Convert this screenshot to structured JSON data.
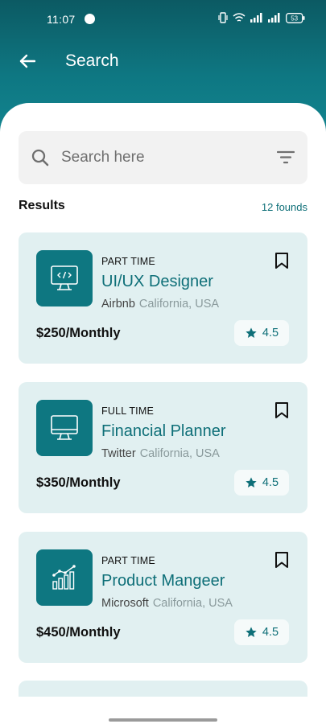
{
  "status_bar": {
    "time": "11:07",
    "battery": "53"
  },
  "header": {
    "title": "Search",
    "back_icon": "arrow-left-icon"
  },
  "search": {
    "placeholder": "Search here",
    "value": "",
    "icon": "search-icon",
    "filter_icon": "filter-icon"
  },
  "results": {
    "title": "Results",
    "count": "12 founds"
  },
  "jobs": [
    {
      "type": "PART TIME",
      "title": "UI/UX Designer",
      "company": "Airbnb",
      "location": "California, USA",
      "salary": "$250/Monthly",
      "rating": "4.5",
      "logo_icon": "code-monitor-icon"
    },
    {
      "type": "FULL TIME",
      "title": "Financial Planner",
      "company": "Twitter",
      "location": "California, USA",
      "salary": "$350/Monthly",
      "rating": "4.5",
      "logo_icon": "monitor-icon"
    },
    {
      "type": "PART TIME",
      "title": "Product Mangeer",
      "company": "Microsoft",
      "location": "California, USA",
      "salary": "$450/Monthly",
      "rating": "4.5",
      "logo_icon": "chart-icon"
    }
  ],
  "colors": {
    "primary": "#0e7781",
    "card_bg": "#e1f0f1",
    "accent_text": "#0e6f78"
  }
}
